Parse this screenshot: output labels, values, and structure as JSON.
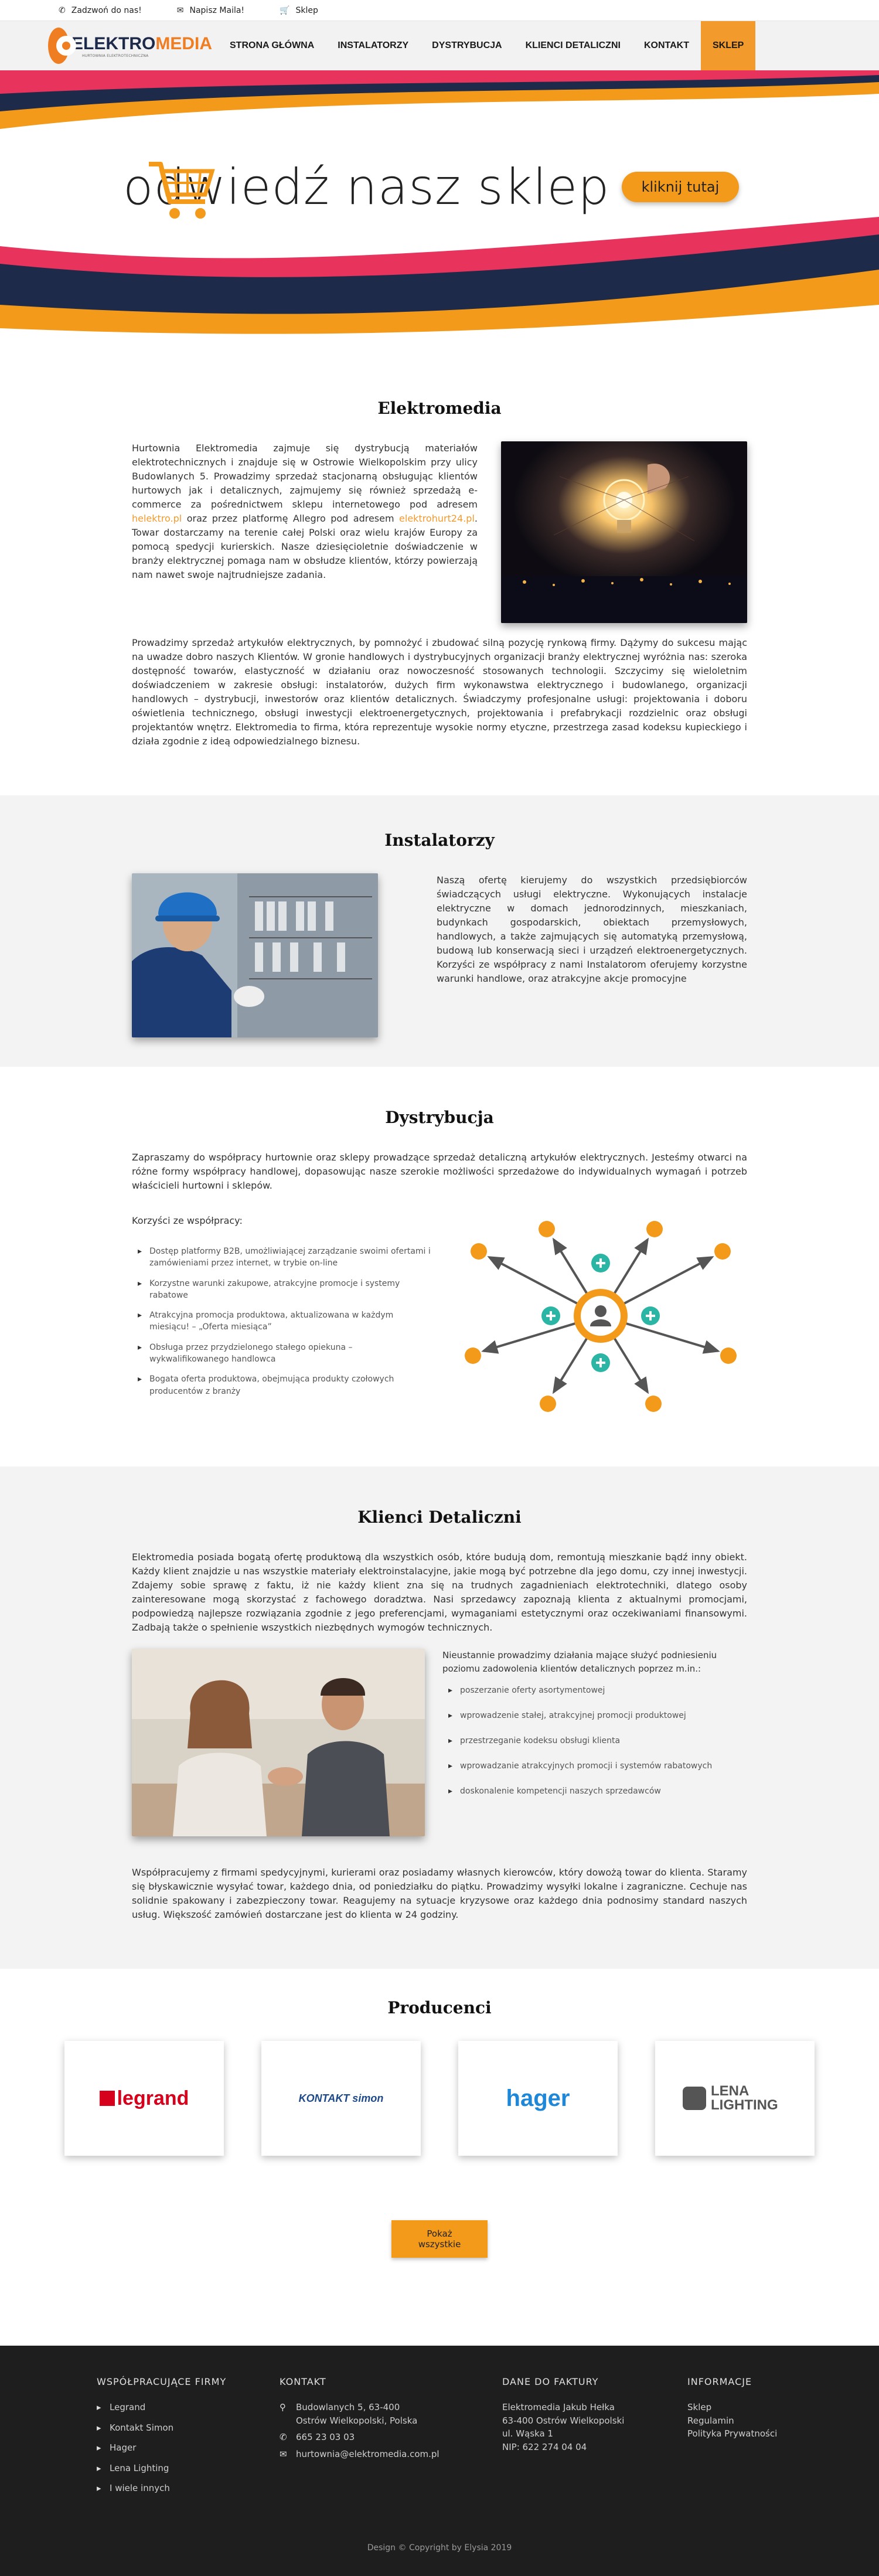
{
  "topbar": {
    "call": "Zadzwoń do nas!",
    "mail": "Napisz Maila!",
    "shop": "Sklep"
  },
  "brand": {
    "name_a": "ELEKTRO",
    "name_b": "MEDIA",
    "tagline": "HURTOWNIA ELEKTROTECHNICZNA"
  },
  "nav": {
    "items": [
      "STRONA GŁÓWNA",
      "INSTALATORZY",
      "DYSTRYBUCJA",
      "KLIENCI DETALICZNI",
      "KONTAKT",
      "SKLEP"
    ],
    "active": "SKLEP"
  },
  "banner": {
    "title": "odwiedź nasz sklep",
    "button": "kliknij tutaj"
  },
  "about": {
    "title": "Elektromedia",
    "p1_a": "Hurtownia Elektromedia zajmuje się dystrybucją materiałów elektrotechnicznych i znajduje się w Ostrowie Wielkopolskim przy ulicy Budowlanych 5. Prowadzimy sprzedaż stacjonarną obsługując klientów hurtowych jak i detalicznych, zajmujemy się również sprzedażą e-commerce za pośrednictwem sklepu internetowego pod adresem ",
    "link1": "helektro.pl",
    "p1_b": " oraz przez platformę Allegro pod adresem ",
    "link2": "elektrohurt24.pl",
    "p1_c": ". Towar dostarczamy na terenie całej Polski oraz wielu krajów Europy za pomocą spedycji kurierskich. Nasze dziesięcioletnie doświadczenie w branży elektrycznej pomaga nam w obsłudze klientów, którzy powierzają nam nawet swoje najtrudniejsze zadania.",
    "p2": "Prowadzimy sprzedaż artykułów elektrycznych, by pomnożyć i zbudować silną pozycję rynkową firmy. Dążymy do sukcesu mając na uwadze dobro naszych Klientów. W gronie handlowych i dystrybucyjnych organizacji branży elektrycznej wyróżnia nas: szeroka dostępność towarów, elastyczność w działaniu oraz nowoczesność stosowanych technologii. Szczycimy się wieloletnim doświadczeniem w zakresie obsługi: instalatorów, dużych firm wykonawstwa elektrycznego i budowlanego, organizacji handlowych – dystrybucji, inwestorów oraz klientów detalicznych. Świadczymy profesjonalne usługi: projektowania i doboru oświetlenia technicznego, obsługi inwestycji elektroenergetycznych, projektowania i prefabrykacji rozdzielnic oraz obsługi projektantów wnętrz. Elektromedia to firma, która reprezentuje wysokie normy etyczne, przestrzega zasad kodeksu kupieckiego i działa zgodnie z ideą odpowiedzialnego biznesu."
  },
  "installers": {
    "title": "Instalatorzy",
    "text": "Naszą ofertę kierujemy do wszystkich przedsiębiorców świadczących usługi elektryczne. Wykonujących instalacje elektryczne w domach jednorodzinnych, mieszkaniach, budynkach gospodarskich, obiektach przemysłowych, handlowych, a także zajmujących się automatyką przemysłową, budową lub konserwacją sieci i urządzeń elektroenergetycznych. Korzyści ze współpracy z nami Instalatorom oferujemy korzystne warunki handlowe, oraz atrakcyjne akcje promocyjne"
  },
  "distribution": {
    "title": "Dystrybucja",
    "intro": "Zapraszamy do współpracy hurtownie oraz sklepy prowadzące sprzedaż detaliczną artykułów elektrycznych. Jesteśmy otwarci na różne formy współpracy handlowej, dopasowując nasze szerokie możliwości sprzedażowe do indywidualnych wymagań i potrzeb właścicieli hurtowni i sklepów.",
    "benefits_label": "Korzyści ze współpracy:",
    "benefits": [
      "Dostęp platformy B2B, umożliwiającej zarządzanie swoimi ofertami i zamówieniami przez internet, w trybie on-line",
      "Korzystne warunki zakupowe, atrakcyjne promocje i systemy rabatowe",
      "Atrakcyjna promocja produktowa, aktualizowana w każdym miesiącu! – „Oferta miesiąca”",
      "Obsługa przez przydzielonego stałego opiekuna – wykwalifikowanego handlowca",
      "Bogata oferta produktowa, obejmująca produkty czołowych producentów z branży"
    ]
  },
  "retail": {
    "title": "Klienci Detaliczni",
    "intro": "Elektromedia posiada bogatą ofertę produktową dla wszystkich osób, które budują dom, remontują mieszkanie bądź inny obiekt. Każdy klient znajdzie u nas wszystkie materiały elektroinstalacyjne, jakie mogą być potrzebne dla jego domu, czy innej inwestycji. Zdajemy sobie sprawę z faktu, iż nie każdy klient zna się na trudnych zagadnieniach elektrotechniki, dlatego osoby zainteresowane mogą skorzystać z fachowego doradztwa. Nasi sprzedawcy zapoznają klienta z aktualnymi promocjami, podpowiedzą najlepsze rozwiązania zgodnie z jego preferencjami, wymaganiami estetycznymi oraz oczekiwaniami finansowymi. Zadbają także o spełnienie wszystkich niezbędnych wymogów technicznych.",
    "list_intro": "Nieustannie prowadzimy działania mające służyć podniesieniu poziomu zadowolenia klientów detalicznych poprzez m.in.:",
    "items": [
      "poszerzanie oferty asortymentowej",
      "wprowadzenie stałej, atrakcyjnej promocji produktowej",
      "przestrzeganie kodeksu obsługi klienta",
      "wprowadzanie atrakcyjnych promocji i systemów rabatowych",
      "doskonalenie kompetencji naszych sprzedawców"
    ],
    "outro": "Współpracujemy z firmami spedycyjnymi, kurierami oraz posiadamy własnych kierowców, który dowożą towar do klienta. Staramy się błyskawicznie wysyłać towar, każdego dnia, od poniedziałku do piątku. Prowadzimy wysyłki lokalne i zagraniczne. Cechuje nas solidnie spakowany i zabezpieczony towar. Reagujemy na sytuacje kryzysowe oraz każdego dnia podnosimy standard naszych usług. Większość zamówień dostarczane jest do klienta w 24 godziny."
  },
  "producers": {
    "title": "Producenci",
    "brands": [
      "legrand",
      "KONTAKT simon",
      "hager",
      "LENA LIGHTING"
    ],
    "show_all": "Pokaż wszystkie"
  },
  "footer": {
    "firms_title": "WSPÓŁPRACUJĄCE FIRMY",
    "firms": [
      "Legrand",
      "Kontakt Simon",
      "Hager",
      "Lena Lighting",
      "I wiele innych"
    ],
    "contact_title": "KONTAKT",
    "address_1": "Budowlanych 5, 63-400",
    "address_2": "Ostrów Wielkopolski, Polska",
    "phone": "665 23 03 03",
    "email": "hurtownia@elektromedia.com.pl",
    "invoice_title": "DANE DO FAKTURY",
    "invoice_lines": [
      "Elektromedia Jakub Hełka",
      "63-400 Ostrów Wielkopolski",
      "ul. Wąska 1",
      "NIP: 622 274 04 04"
    ],
    "info_title": "INFORMACJE",
    "info_links": [
      "Sklep",
      "Regulamin",
      "Polityka Prywatności"
    ],
    "copyright": "Design © Copyright by Elysia 2019"
  },
  "colors": {
    "accent": "#f39a2c",
    "navy": "#1e2a4a",
    "pink": "#e8335c",
    "footer_bg": "#1e1e1e"
  }
}
